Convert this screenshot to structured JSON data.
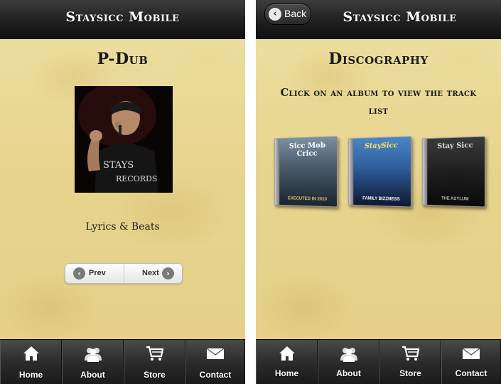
{
  "left_screen": {
    "header": {
      "title": "Staysicc Mobile"
    },
    "page_title": "P-Dub",
    "photo_text": "STAYS RECORDS",
    "subtitle": "Lyrics & Beats",
    "pager": {
      "prev_label": "Prev",
      "next_label": "Next"
    }
  },
  "right_screen": {
    "header": {
      "title": "Staysicc Mobile",
      "back_label": "Back"
    },
    "page_title": "Discography",
    "instructions": "Click on an album to view the track list",
    "albums": [
      {
        "cover_title": "Sicc Mob Cricc",
        "cover_subtitle": "EXECUTED IN 2010"
      },
      {
        "cover_title": "StaySicc",
        "cover_subtitle": "FAMILY BIZZNESS"
      },
      {
        "cover_title": "Stay Sicc",
        "cover_subtitle": "THE ASYLUM"
      }
    ]
  },
  "footer": {
    "items": [
      {
        "label": "Home",
        "icon": "home-icon"
      },
      {
        "label": "About",
        "icon": "people-icon"
      },
      {
        "label": "Store",
        "icon": "cart-icon"
      },
      {
        "label": "Contact",
        "icon": "envelope-icon"
      }
    ]
  },
  "colors": {
    "header_bg": "#1e1e1e",
    "parchment": "#e7d58f",
    "text_dark": "#1a1a1a"
  }
}
